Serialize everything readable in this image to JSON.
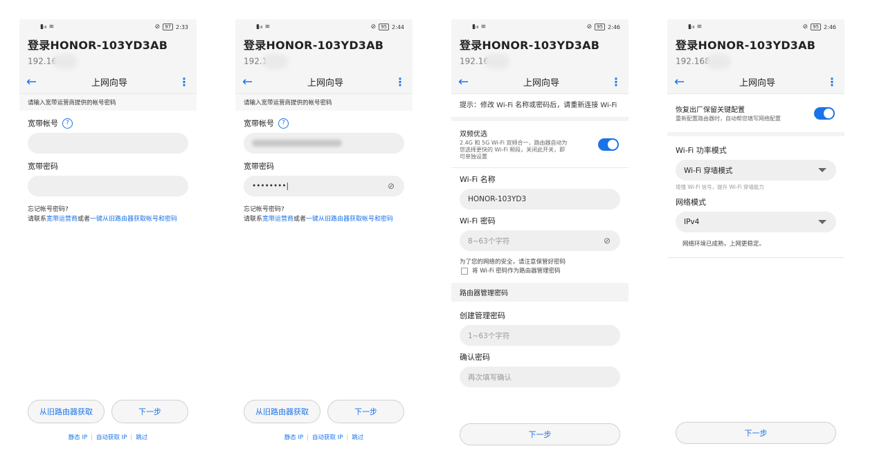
{
  "common": {
    "title": "登录HONOR-103YD3AB",
    "appbar_title": "上网向导"
  },
  "phone1": {
    "time": "2:33",
    "battery": "97",
    "ip": "192.16",
    "hint": "请输入宽带运营商提供的帐号密码",
    "account_label": "宽带帐号",
    "password_label": "宽带密码",
    "forgot_title": "忘记帐号密码?",
    "forgot_prefix": "请联系",
    "forgot_link1": "宽带运营商",
    "forgot_mid": "或者",
    "forgot_link2": "一键从旧路由器获取帐号和密码",
    "btn_old": "从旧路由器获取",
    "btn_next": "下一步",
    "footer_static": "静态 IP",
    "footer_auto": "自动获取 IP",
    "footer_skip": "跳过"
  },
  "phone2": {
    "time": "2:44",
    "battery": "95",
    "ip": "192.1",
    "hint": "请输入宽带运营商提供的帐号密码",
    "account_label": "宽带帐号",
    "password_label": "宽带密码",
    "password_value": "••••••••|",
    "forgot_title": "忘记帐号密码?",
    "forgot_prefix": "请联系",
    "forgot_link1": "宽带运营商",
    "forgot_mid": "或者",
    "forgot_link2": "一键从旧路由器获取帐号和密码",
    "btn_old": "从旧路由器获取",
    "btn_next": "下一步",
    "footer_static": "静态 IP",
    "footer_auto": "自动获取 IP",
    "footer_skip": "跳过"
  },
  "phone3": {
    "time": "2:46",
    "battery": "95",
    "ip": "192.16",
    "tip": "提示：修改 Wi-Fi 名称或密码后，请重新连接 Wi-Fi",
    "dual_title": "双频优选",
    "dual_desc": "2.4G 和 5G Wi-Fi 双频合一，路由器自动为您选择更快的 Wi-Fi 频段，关闭此开关，即可单独设置",
    "wifi_name_label": "Wi-Fi 名称",
    "wifi_name_value": "HONOR-103YD3",
    "wifi_pwd_label": "Wi-Fi 密码",
    "wifi_pwd_placeholder": "8~63个字符",
    "security_note": "为了您的网络的安全，请注意保管好密码",
    "checkbox_label": "将 Wi-Fi 密码作为路由器管理密码",
    "section_admin": "路由器管理密码",
    "create_label": "创建管理密码",
    "create_placeholder": "1~63个字符",
    "confirm_label": "确认密码",
    "confirm_placeholder": "再次填写确认",
    "btn_next": "下一步"
  },
  "phone4": {
    "time": "2:46",
    "battery": "95",
    "ip": "192.168",
    "restore_title": "恢复出厂保留关键配置",
    "restore_desc": "重新配置路由器时，自动帮您填写网络配置",
    "power_label": "Wi-Fi 功率模式",
    "power_value": "Wi-Fi 穿墙模式",
    "power_note": "增强 Wi-Fi 信号，提升 Wi-Fi 穿墙能力",
    "net_label": "网络模式",
    "net_value": "IPv4",
    "net_note": "网络环境已成熟，上网更稳定。",
    "btn_next": "下一步"
  },
  "colors": {
    "accent": "#1a73e8",
    "field": "#efefef",
    "bg": "#f5f5f5"
  }
}
